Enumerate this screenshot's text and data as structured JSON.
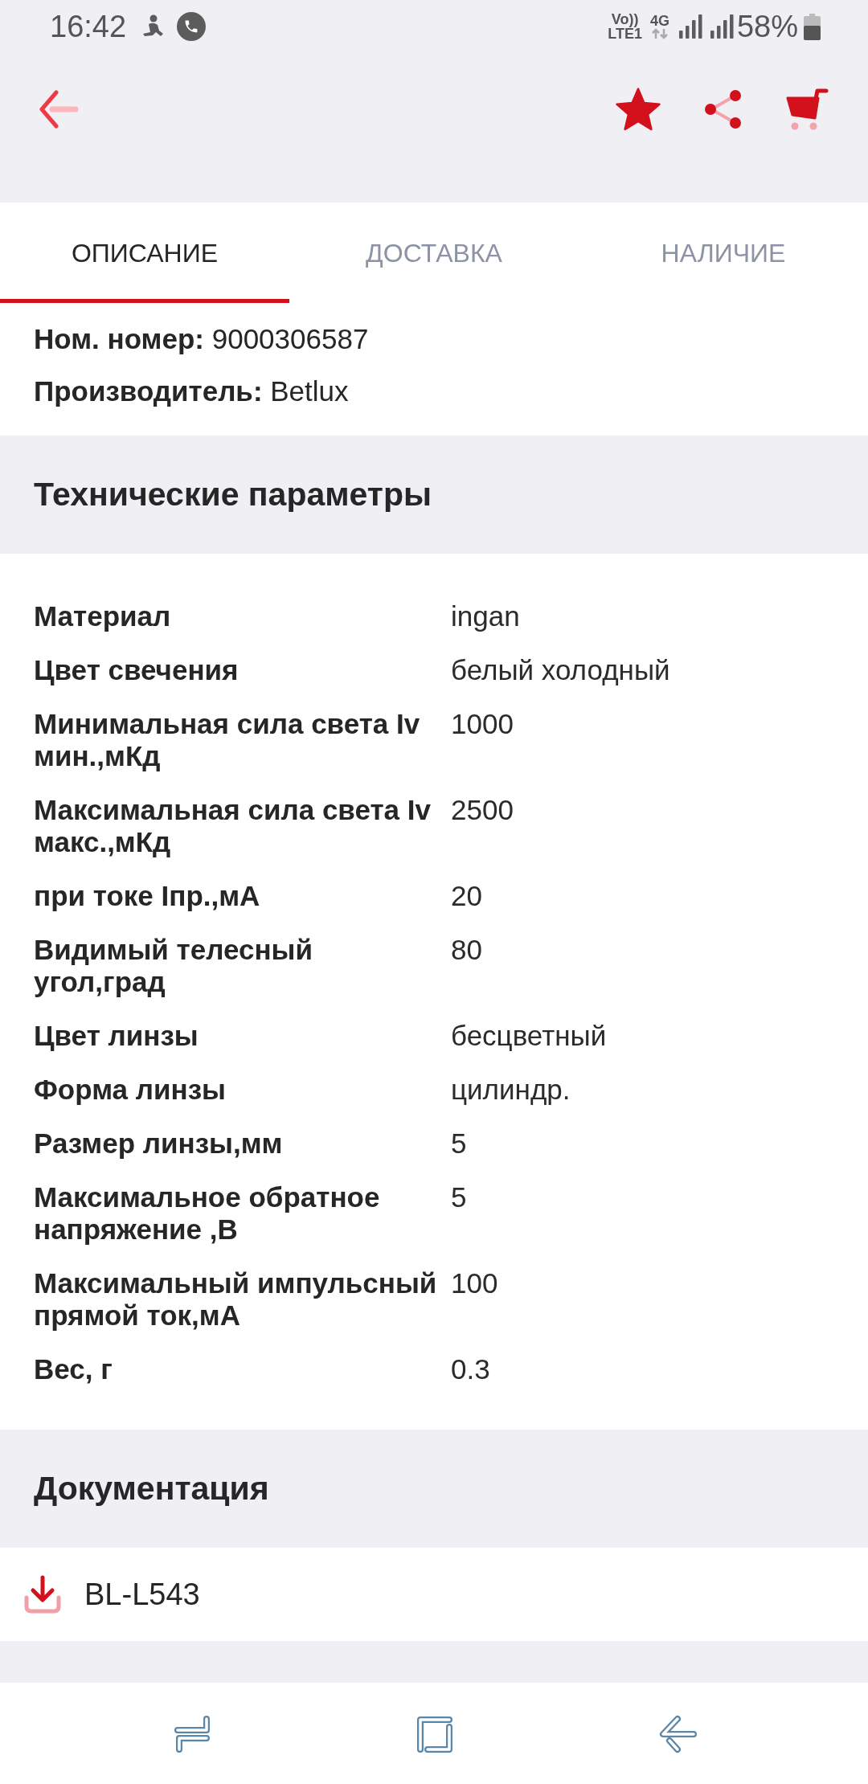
{
  "status_bar": {
    "time": "16:42",
    "volte": "Vo))",
    "lte": "LTE1",
    "network": "4G",
    "battery": "58%"
  },
  "toolbar": {
    "favorite": true
  },
  "tabs": [
    {
      "label": "ОПИСАНИЕ",
      "selected": true
    },
    {
      "label": "ДОСТАВКА",
      "selected": false
    },
    {
      "label": "НАЛИЧИЕ",
      "selected": false
    }
  ],
  "info": [
    "**Ном. номер:** 9000306587",
    "**Производитель:** Betlux"
  ],
  "specs": {
    "title": "Технические параметры",
    "rows": [
      {
        "name": "Материал",
        "value": "ingan"
      },
      {
        "name": "Цвет свечения",
        "value": "белый холодный"
      },
      {
        "name": "Минимальная сила света Iv мин.,мКд",
        "value": "1000"
      },
      {
        "name": "Максимальная сила света Iv макс.,мКд",
        "value": "2500"
      },
      {
        "name": "при токе Iпр.,мА",
        "value": "20"
      },
      {
        "name": "Видимый телесный угол,град",
        "value": "80"
      },
      {
        "name": "Цвет линзы",
        "value": "бесцветный"
      },
      {
        "name": "Форма линзы",
        "value": "цилиндр."
      },
      {
        "name": "Размер линзы,мм",
        "value": "5"
      },
      {
        "name": "Максимальное обратное напряжение ,В",
        "value": "5"
      },
      {
        "name": "Максимальный импульсный прямой ток,мА",
        "value": "100"
      },
      {
        "name": "Вес, г",
        "value": "0.3"
      }
    ]
  },
  "documents": {
    "title": "Документация",
    "items": [
      {
        "name": "BL-L543"
      }
    ]
  }
}
